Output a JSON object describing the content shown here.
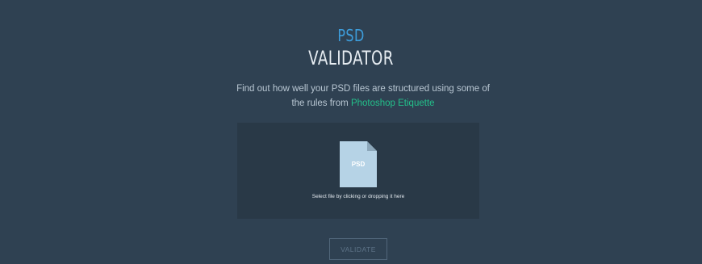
{
  "logo": {
    "line1": "PSD",
    "line2": "VALIDATOR"
  },
  "description": {
    "text": "Find out how well your PSD files are structured using some of the rules from",
    "link_label": "Photoshop Etiquette"
  },
  "dropzone": {
    "icon_label": "PSD",
    "hint": "Select file by clicking or dropping it here"
  },
  "actions": {
    "validate_label": "VALIDATE"
  },
  "colors": {
    "background": "#2f4152",
    "dropzone": "#293947",
    "logo_accent": "#3d9ddb",
    "link": "#23c08a",
    "file_icon": "#b6d3e6"
  }
}
